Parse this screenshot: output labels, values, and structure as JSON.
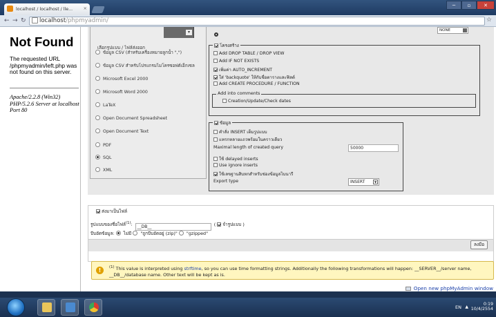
{
  "browser": {
    "tab_title": "localhost / localhost / lle...",
    "tab_close": "×",
    "url_host": "localhost",
    "url_path": "/phpmyadmin/",
    "window_buttons": [
      "─",
      "▫",
      "✕"
    ]
  },
  "error_page": {
    "title": "Not Found",
    "message": "The requested URL /phpmyadmin/left.php was not found on this server.",
    "server_info": "Apache/2.2.8 (Win32) PHP/5.2.6 Server at localhost Port 80"
  },
  "export_format": {
    "legend": "เลือกรูปแบบ / ไฟล์ส่งออก",
    "options": [
      {
        "label": "ข้อมูล CSV (สำหรับเครื่องหมายลูกน้ำ \",\")",
        "selected": false
      },
      {
        "label": "ข้อมูล CSV สำหรับโปรแกรมไมโครซอฟต์เอ็กเซล",
        "selected": false
      },
      {
        "label": "Microsoft Excel 2000",
        "selected": false
      },
      {
        "label": "Microsoft Word 2000",
        "selected": false
      },
      {
        "label": "LaTeX",
        "selected": false
      },
      {
        "label": "Open Document Spreadsheet",
        "selected": false
      },
      {
        "label": "Open Document Text",
        "selected": false
      },
      {
        "label": "PDF",
        "selected": false
      },
      {
        "label": "SQL",
        "selected": true
      },
      {
        "label": "XML",
        "selected": false
      }
    ],
    "top_dropdown": "NONE"
  },
  "structure": {
    "legend": "โครงสร้าง",
    "checked": true,
    "options": [
      {
        "label": "Add DROP TABLE / DROP VIEW",
        "checked": false
      },
      {
        "label": "Add IF NOT EXISTS",
        "checked": false
      },
      {
        "label": "เพิ่มค่า AUTO_INCREMENT",
        "checked": true
      },
      {
        "label": "ใส่ 'backquote' ให้กับชื่อตารางและฟิลด์",
        "checked": true
      },
      {
        "label": "Add CREATE PROCEDURE / FUNCTION",
        "checked": false
      }
    ],
    "comments_legend": "Add into comments",
    "comments_option": "Creation/Update/Check dates"
  },
  "data_section": {
    "legend": "ข้อมูล",
    "checked": true,
    "options": [
      {
        "label": "คำสั่ง INSERT เต็มรูปแบบ",
        "checked": false
      },
      {
        "label": "แทรกหลายแถวพร้อมในคราวเดียว",
        "checked": false
      }
    ],
    "max_query_label": "Maximal length of created query",
    "max_query_value": "50000",
    "options2": [
      {
        "label": "ใช้ delayed inserts",
        "checked": false
      },
      {
        "label": "Use ignore inserts",
        "checked": false
      },
      {
        "label": "ใช้เลขฐานสิบหกสำหรับช่องข้อมูลไบนารี",
        "checked": true
      }
    ],
    "export_type_label": "Export type",
    "export_type_value": "INSERT",
    "export_type_arrow": "▼"
  },
  "save_file": {
    "header_label": "ส่งมาเป็นไฟล์",
    "header_checked": true,
    "template_label": "รูปแบบของชื่อไฟล์",
    "template_sup": "(1)",
    "template_value": "__DB__",
    "remember_label": "จำรูปแบบ",
    "remember_checked": true,
    "compression_label": "บีบอัดข้อมูล",
    "compression_options": [
      {
        "label": "ไม่มี",
        "selected": true
      },
      {
        "label": "\"ถูกบีบอัดอยู่ (zip)\"",
        "selected": false
      },
      {
        "label": "\"gzipped\"",
        "selected": false
      }
    ],
    "go_button": "ลงมือ"
  },
  "notice": {
    "sup": "(1)",
    "text_before": " This value is interpreted using ",
    "link": "strftime",
    "text_after": ", so you can use time formatting strings. Additionally the following transformations will happen: __SERVER__/server name, __DB__/database name. Other text will be kept as is."
  },
  "open_window_link": "Open new phpMyAdmin window",
  "taskbar": {
    "language": "EN",
    "time": "0:19",
    "date": "10/4/2554"
  },
  "colors": {
    "link": "#1a3fa8",
    "notice_bg": "#fff6bf",
    "panel_bg": "#e8e8e8"
  }
}
